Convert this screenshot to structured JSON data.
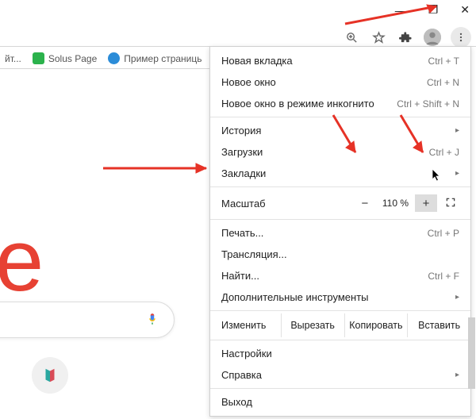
{
  "window": {
    "min": "—",
    "max": "❐",
    "close": "✕"
  },
  "bookmarks": {
    "item0_suffix": "йт...",
    "item1": "Solus Page",
    "item2": "Пример страниць"
  },
  "menu": {
    "new_tab": "Новая вкладка",
    "new_tab_sc": "Ctrl + T",
    "new_window": "Новое окно",
    "new_window_sc": "Ctrl + N",
    "incognito": "Новое окно в режиме инкогнито",
    "incognito_sc": "Ctrl + Shift + N",
    "history": "История",
    "downloads": "Загрузки",
    "downloads_sc": "Ctrl + J",
    "bookmarks": "Закладки",
    "zoom": "Масштаб",
    "zoom_minus": "−",
    "zoom_value": "110 %",
    "zoom_plus": "+",
    "print": "Печать...",
    "print_sc": "Ctrl + P",
    "cast": "Трансляция...",
    "find": "Найти...",
    "find_sc": "Ctrl + F",
    "more_tools": "Дополнительные инструменты",
    "edit": "Изменить",
    "cut": "Вырезать",
    "copy": "Копировать",
    "paste": "Вставить",
    "settings": "Настройки",
    "help": "Справка",
    "exit": "Выход"
  },
  "chevron": "▸"
}
